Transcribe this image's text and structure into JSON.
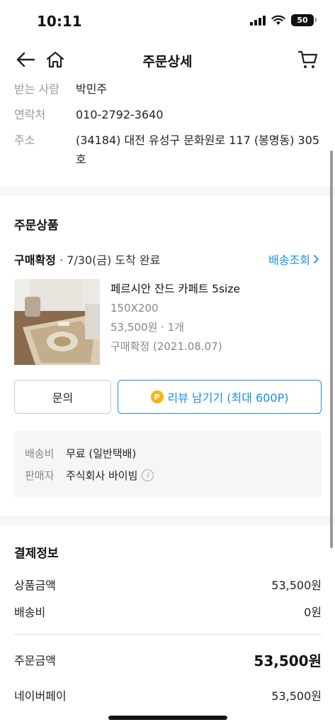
{
  "status_bar": {
    "time": "10:11",
    "battery": "50"
  },
  "header": {
    "title": "주문상세"
  },
  "recipient": {
    "name_label": "받는 사람",
    "name": "박민주",
    "phone_label": "연락처",
    "phone": "010-2792-3640",
    "address_label": "주소",
    "address_line1": "(34184) 대전 유성구 문화원로 117 (봉명동) 305",
    "address_line2": "호"
  },
  "order_items": {
    "section_title": "주문상품",
    "status_bold": "구매확정",
    "status_detail": " · 7/30(금) 도착 완료",
    "tracking_label": "배송조회",
    "product": {
      "name": "페르시안 잔드 카페트 5size",
      "option": "150X200",
      "price_qty": "53,500원 · 1개",
      "confirm": "구매확정 (2021.08.07)"
    },
    "inquiry_button": "문의",
    "review_coin": "P",
    "review_button": "리뷰 남기기 (최대 600P)",
    "shipping_fee_label": "배송비",
    "shipping_fee_value": "무료 (일반택배)",
    "seller_label": "판매자",
    "seller_value": "주식회사 바이빔"
  },
  "payment": {
    "section_title": "결제정보",
    "rows": [
      {
        "label": "상품금액",
        "value": "53,500원"
      },
      {
        "label": "배송비",
        "value": "0원"
      }
    ],
    "total": {
      "label": "주문금액",
      "value": "53,500원"
    },
    "method": {
      "label": "네이버페이",
      "value": "53,500원"
    }
  },
  "colors": {
    "accent_blue": "#1a8fe0",
    "coin_yellow": "#f5b50a",
    "band_gray": "#f5f6f8"
  }
}
